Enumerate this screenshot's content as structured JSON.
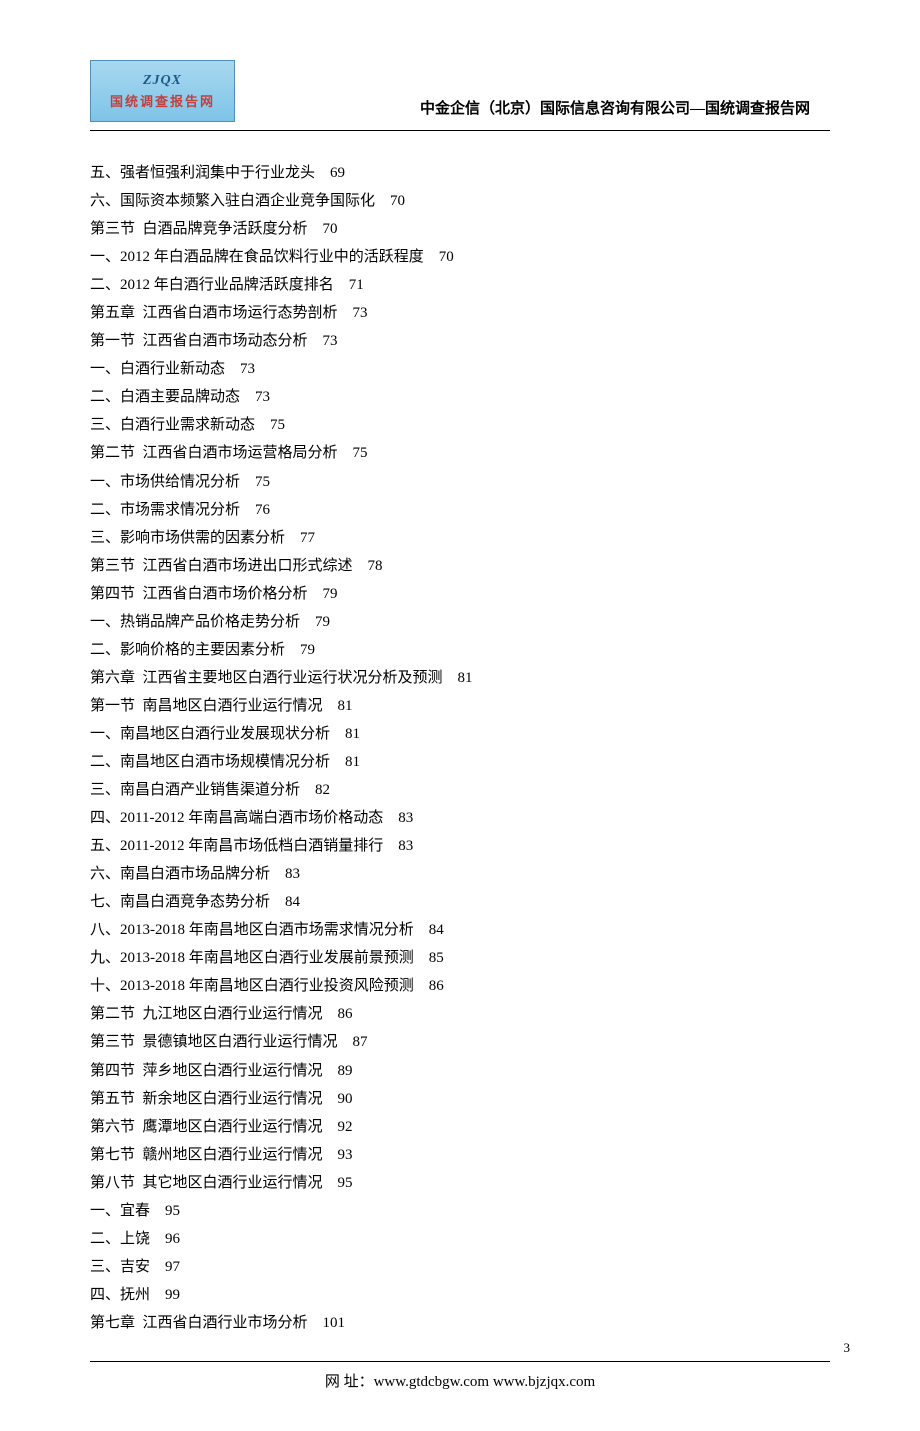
{
  "logo": {
    "top": "ZJQX",
    "bottom": "国统调查报告网"
  },
  "header_title": "中金企信（北京）国际信息咨询有限公司—国统调查报告网",
  "toc_items": [
    {
      "text": "五、强者恒强利润集中于行业龙头",
      "page": "69"
    },
    {
      "text": "六、国际资本频繁入驻白酒企业竞争国际化",
      "page": "70"
    },
    {
      "text": "第三节  白酒品牌竞争活跃度分析",
      "page": "70"
    },
    {
      "text": "一、2012 年白酒品牌在食品饮料行业中的活跃程度",
      "page": "70"
    },
    {
      "text": "二、2012 年白酒行业品牌活跃度排名",
      "page": "71"
    },
    {
      "text": "第五章  江西省白酒市场运行态势剖析",
      "page": "73"
    },
    {
      "text": "第一节  江西省白酒市场动态分析",
      "page": "73"
    },
    {
      "text": "一、白酒行业新动态",
      "page": "73"
    },
    {
      "text": "二、白酒主要品牌动态",
      "page": "73"
    },
    {
      "text": "三、白酒行业需求新动态",
      "page": "75"
    },
    {
      "text": "第二节  江西省白酒市场运营格局分析",
      "page": "75"
    },
    {
      "text": "一、市场供给情况分析",
      "page": "75"
    },
    {
      "text": "二、市场需求情况分析",
      "page": "76"
    },
    {
      "text": "三、影响市场供需的因素分析",
      "page": "77"
    },
    {
      "text": "第三节  江西省白酒市场进出口形式综述",
      "page": "78"
    },
    {
      "text": "第四节  江西省白酒市场价格分析",
      "page": "79"
    },
    {
      "text": "一、热销品牌产品价格走势分析",
      "page": "79"
    },
    {
      "text": "二、影响价格的主要因素分析",
      "page": "79"
    },
    {
      "text": "第六章  江西省主要地区白酒行业运行状况分析及预测",
      "page": "81"
    },
    {
      "text": "第一节  南昌地区白酒行业运行情况",
      "page": "81"
    },
    {
      "text": "一、南昌地区白酒行业发展现状分析",
      "page": "81"
    },
    {
      "text": "二、南昌地区白酒市场规模情况分析",
      "page": "81"
    },
    {
      "text": "三、南昌白酒产业销售渠道分析",
      "page": "82"
    },
    {
      "text": "四、2011-2012 年南昌高端白酒市场价格动态",
      "page": "83"
    },
    {
      "text": "五、2011-2012 年南昌市场低档白酒销量排行",
      "page": "83"
    },
    {
      "text": "六、南昌白酒市场品牌分析",
      "page": "83"
    },
    {
      "text": "七、南昌白酒竞争态势分析",
      "page": "84"
    },
    {
      "text": "八、2013-2018 年南昌地区白酒市场需求情况分析",
      "page": "84"
    },
    {
      "text": "九、2013-2018 年南昌地区白酒行业发展前景预测",
      "page": "85"
    },
    {
      "text": "十、2013-2018 年南昌地区白酒行业投资风险预测",
      "page": "86"
    },
    {
      "text": "第二节  九江地区白酒行业运行情况",
      "page": "86"
    },
    {
      "text": "第三节  景德镇地区白酒行业运行情况",
      "page": "87"
    },
    {
      "text": "第四节  萍乡地区白酒行业运行情况",
      "page": "89"
    },
    {
      "text": "第五节  新余地区白酒行业运行情况",
      "page": "90"
    },
    {
      "text": "第六节  鹰潭地区白酒行业运行情况",
      "page": "92"
    },
    {
      "text": "第七节  赣州地区白酒行业运行情况",
      "page": "93"
    },
    {
      "text": "第八节  其它地区白酒行业运行情况",
      "page": "95"
    },
    {
      "text": "一、宜春",
      "page": "95"
    },
    {
      "text": "二、上饶",
      "page": "96"
    },
    {
      "text": "三、吉安",
      "page": "97"
    },
    {
      "text": "四、抚州",
      "page": "99"
    },
    {
      "text": "第七章  江西省白酒行业市场分析",
      "page": "101"
    }
  ],
  "footer": "网  址：www.gtdcbgw.com        www.bjzjqx.com",
  "page_number": "3"
}
